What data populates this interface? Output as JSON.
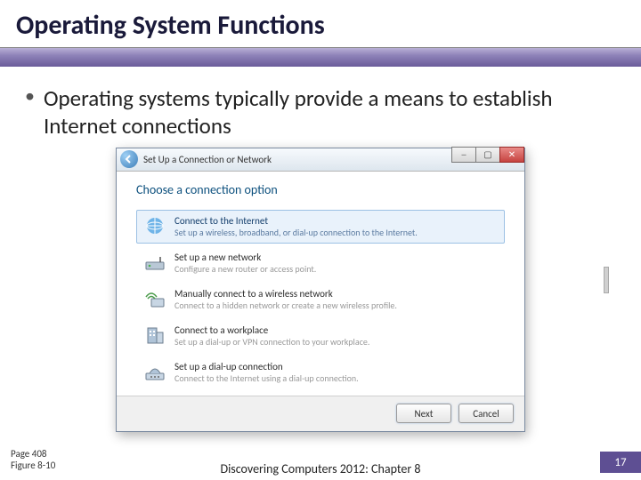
{
  "title": "Operating System Functions",
  "bullet": "Operating systems typically provide a means to establish Internet connections",
  "dialog": {
    "window_title": "Set Up a Connection or Network",
    "heading": "Choose a connection option",
    "options": [
      {
        "title": "Connect to the Internet",
        "sub": "Set up a wireless, broadband, or dial-up connection to the Internet.",
        "selected": true
      },
      {
        "title": "Set up a new network",
        "sub": "Configure a new router or access point."
      },
      {
        "title": "Manually connect to a wireless network",
        "sub": "Connect to a hidden network or create a new wireless profile."
      },
      {
        "title": "Connect to a workplace",
        "sub": "Set up a dial-up or VPN connection to your workplace."
      },
      {
        "title": "Set up a dial-up connection",
        "sub": "Connect to the Internet using a dial-up connection."
      }
    ],
    "next": "Next",
    "cancel": "Cancel"
  },
  "footer": {
    "page": "Page 408",
    "figure": "Figure 8-10",
    "center": "Discovering Computers 2012: Chapter 8",
    "slide": "17"
  }
}
